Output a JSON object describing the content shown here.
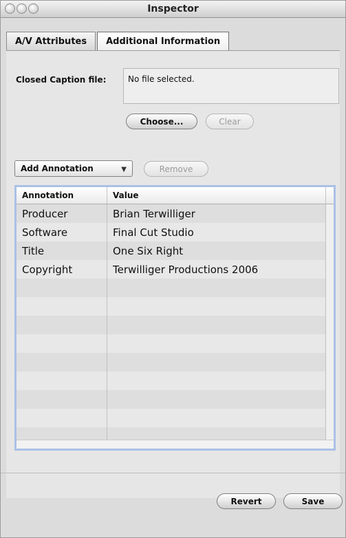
{
  "window": {
    "title": "Inspector"
  },
  "tabs": [
    {
      "label": "A/V Attributes",
      "active": false
    },
    {
      "label": "Additional Information",
      "active": true
    }
  ],
  "closed_caption": {
    "label": "Closed Caption file:",
    "value": "No file selected."
  },
  "buttons": {
    "choose": "Choose...",
    "clear": "Clear",
    "remove": "Remove",
    "revert": "Revert",
    "save": "Save"
  },
  "annotation_popup": {
    "selected": "Add Annotation"
  },
  "table": {
    "headers": [
      "Annotation",
      "Value"
    ],
    "rows": [
      {
        "annotation": "Producer",
        "value": "Brian Terwilliger"
      },
      {
        "annotation": "Software",
        "value": "Final Cut Studio"
      },
      {
        "annotation": "Title",
        "value": "One Six Right"
      },
      {
        "annotation": "Copyright",
        "value": "Terwilliger Productions 2006"
      },
      {
        "annotation": "",
        "value": ""
      },
      {
        "annotation": "",
        "value": ""
      },
      {
        "annotation": "",
        "value": ""
      },
      {
        "annotation": "",
        "value": ""
      },
      {
        "annotation": "",
        "value": ""
      },
      {
        "annotation": "",
        "value": ""
      },
      {
        "annotation": "",
        "value": ""
      },
      {
        "annotation": "",
        "value": ""
      },
      {
        "annotation": "",
        "value": ""
      }
    ]
  },
  "icons": [
    "window-close-icon",
    "window-minimize-icon",
    "window-zoom-icon",
    "chevron-down-icon"
  ]
}
